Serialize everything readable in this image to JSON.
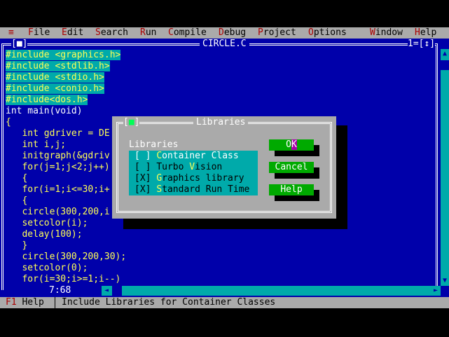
{
  "menu": {
    "system_icon": "≡",
    "items": [
      {
        "hot": "F",
        "rest": "ile"
      },
      {
        "hot": "E",
        "rest": "dit"
      },
      {
        "hot": "S",
        "rest": "earch"
      },
      {
        "hot": "R",
        "rest": "un"
      },
      {
        "hot": "C",
        "rest": "ompile"
      },
      {
        "hot": "D",
        "rest": "ebug"
      },
      {
        "hot": "P",
        "rest": "roject"
      },
      {
        "hot": "O",
        "rest": "ptions"
      },
      {
        "hot": "W",
        "rest": "indow"
      },
      {
        "hot": "H",
        "rest": "elp"
      }
    ]
  },
  "editor": {
    "title": "CIRCLE.C",
    "close_box": "[■]",
    "window_controls": "1=[↕]",
    "cursor_position": "7:68",
    "lines": [
      "#include <graphics.h>",
      "#include <stdlib.h>",
      "#include <stdio.h>",
      "#include <conio.h>",
      "#include<dos.h>",
      "int main(void)",
      "{",
      "   int gdriver = DE",
      "   int i,j;",
      "   initgraph(&gdriv",
      "   for(j=1;j<2;j++)",
      "   {",
      "   for(i=1;i<=30;i+",
      "   {",
      "   circle(300,200,i",
      "   setcolor(i);",
      "   delay(100);",
      "   }",
      "   circle(300,200,30);",
      "   setcolor(0);",
      "   for(i=30;i>=1;i--)"
    ]
  },
  "scrollbars": {
    "up_arrow": "▲",
    "down_arrow": "▼",
    "left_arrow": "◄",
    "right_arrow": "►"
  },
  "dialog": {
    "title": "Libraries",
    "close_box_left": "[",
    "close_box_dot": "■",
    "close_box_right": "]",
    "group_label": "Libraries",
    "options": [
      {
        "box": "[ ]",
        "hot": "C",
        "rest": "ontainer Class",
        "checked": false
      },
      {
        "box": "[ ]",
        "pre": "Turbo ",
        "hot": "V",
        "rest": "ision",
        "checked": false
      },
      {
        "box": "[X]",
        "hot": "G",
        "rest": "raphics library",
        "checked": true
      },
      {
        "box": "[X]",
        "hot": "S",
        "rest": "tandard Run Time",
        "checked": true
      }
    ],
    "buttons": {
      "ok_pre": "O",
      "ok_hot": "K",
      "cancel": "Cancel",
      "help": "Help"
    }
  },
  "status": {
    "f1_key": "F1",
    "f1_label": " Help",
    "hint": "Include Libraries for Container Classes"
  },
  "colors": {
    "desktop_blue": "#0000aa",
    "menu_gray": "#aaaaaa",
    "hotkey_red": "#aa0000",
    "include_highlight": "#00aaaa",
    "code_yellow": "#ffff55",
    "button_green": "#00aa00"
  }
}
